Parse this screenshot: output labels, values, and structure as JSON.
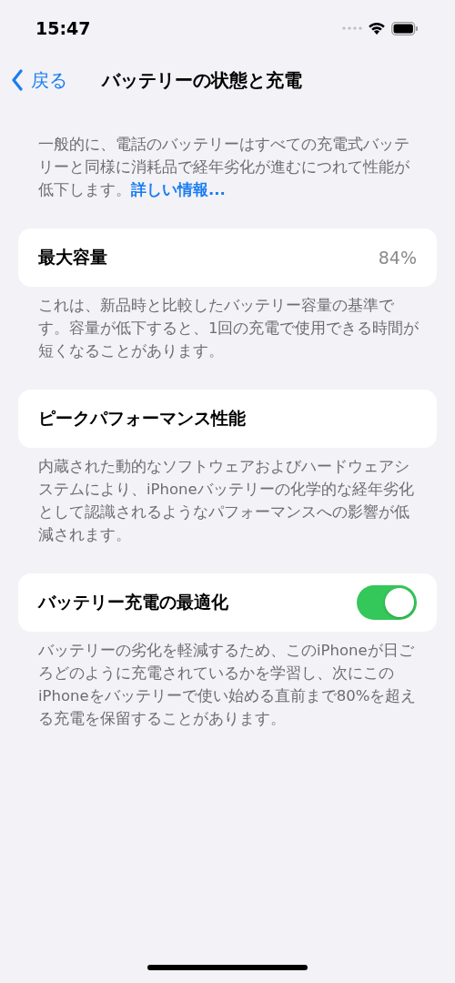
{
  "status_bar": {
    "time": "15:47"
  },
  "nav": {
    "back": "戻る",
    "title": "バッテリーの状態と充電"
  },
  "intro": {
    "text": "一般的に、電話のバッテリーはすべての充電式バッテリーと同様に消耗品で経年劣化が進むにつれて性能が低下します。",
    "link": "詳しい情報..."
  },
  "sections": [
    {
      "kind": "value",
      "label": "最大容量",
      "value": "84%",
      "footer": "これは、新品時と比較したバッテリー容量の基準です。容量が低下すると、1回の充電で使用できる時間が短くなることがあります。"
    },
    {
      "kind": "plain",
      "label": "ピークパフォーマンス性能",
      "footer": "内蔵された動的なソフトウェアおよびハードウェアシステムにより、iPhoneバッテリーの化学的な経年劣化として認識されるようなパフォーマンスへの影響が低減されます。"
    },
    {
      "kind": "toggle",
      "label": "バッテリー充電の最適化",
      "on": true,
      "footer": "バッテリーの劣化を軽減するため、このiPhoneが日ごろどのように充電されているかを学習し、次にこのiPhoneをバッテリーで使い始める直前まで80%を超える充電を保留することがあります。"
    }
  ]
}
